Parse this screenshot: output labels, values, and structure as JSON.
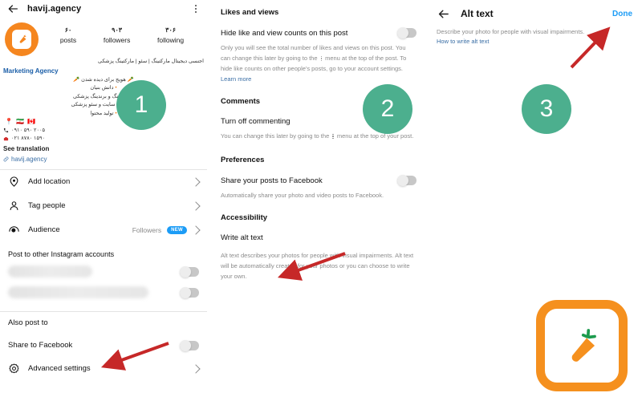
{
  "steps": [
    {
      "number": "1"
    },
    {
      "number": "2"
    },
    {
      "number": "3"
    }
  ],
  "colors": {
    "step_circle": "#4CAF8E",
    "brand_orange": "#F5901E",
    "link_blue": "#3a6ea5",
    "action_blue": "#1c9cf6",
    "arrow_red": "#C62828",
    "muted_text": "#8b8b8b"
  },
  "panel1": {
    "topbar": {
      "back_icon": "arrow-left-icon",
      "title": "havij.agency",
      "menu_icon": "kebab-menu-icon"
    },
    "profile": {
      "avatar_icon": "carrot-logo-avatar",
      "stats": [
        {
          "number": "۶۰",
          "label": "posts"
        },
        {
          "number": "۹۰۳",
          "label": "followers"
        },
        {
          "number": "۳۰۶",
          "label": "following"
        }
      ],
      "bio_headline": "اجنسی دیجیتال مارکتینگ | سئو | مارکتینگ پزشکی",
      "category": "Marketing Agency",
      "tagline": "🥕 هویج برای دیده شدن 🥕",
      "bullets": [
        "دانش بنیان",
        "مارکتینگ و برندینگ پزشکی",
        "طراحی سایت و سئو پزشکی",
        "تولید محتوا"
      ],
      "flags": "📍 🇮🇷 🇨🇦",
      "phone1_icon": "phone-icon",
      "phone1": "۰۹۱۰ ۵۹۰ ۲۰۰۵",
      "phone2_icon": "telephone-icon",
      "phone2": "۰۲۱ ۸۷۸۰ ۱۵۹۰",
      "see_translation": "See translation",
      "link_icon": "link-icon",
      "link_text": "havij.agency"
    },
    "rows": [
      {
        "icon": "location-pin-icon",
        "label": "Add location",
        "value": "",
        "badge": "",
        "chevron": true
      },
      {
        "icon": "person-icon",
        "label": "Tag people",
        "value": "",
        "badge": "",
        "chevron": true
      },
      {
        "icon": "audience-icon",
        "label": "Audience",
        "value": "Followers",
        "badge": "NEW",
        "chevron": true
      }
    ],
    "other_accounts_title": "Post to other Instagram accounts",
    "blurred_rows": [
      {
        "toggle": "off"
      },
      {
        "toggle": "off"
      }
    ],
    "also_post_to_title": "Also post to",
    "share_facebook_label": "Share to Facebook",
    "share_facebook_toggle": "off",
    "advanced_settings": {
      "icon": "gear-icon",
      "label": "Advanced settings",
      "chevron": true
    }
  },
  "panel2": {
    "likes_heading": "Likes and views",
    "hide_counts_label": "Hide like and view counts on this post",
    "hide_counts_toggle": "off",
    "hide_counts_body_a": "Only you will see the total number of likes and views on this post. You can change this later by going to the",
    "hide_counts_body_b": "menu at the top of the post. To hide like counts on other people's posts, go to your account settings.",
    "learn_more": "Learn more",
    "comments_heading": "Comments",
    "turn_off_commenting_label": "Turn off commenting",
    "commenting_body_a": "You can change this later by going to the",
    "commenting_body_b": "menu at the top of your post.",
    "preferences_heading": "Preferences",
    "share_posts_fb_label": "Share your posts to Facebook",
    "share_posts_fb_toggle": "off",
    "share_posts_fb_body": "Automatically share your photo and video posts to Facebook.",
    "accessibility_heading": "Accessibility",
    "write_alt_text_label": "Write alt text",
    "alt_text_body": "Alt text describes your photos for people with visual impairments. Alt text will be automatically created for your photos or you can choose to write your own."
  },
  "panel3": {
    "back_icon": "arrow-left-icon",
    "title": "Alt text",
    "done_label": "Done",
    "subtitle": "Describe your photo for people with visual impairments.",
    "help_link": "How to write alt text"
  },
  "watermark": {
    "icon": "carrot-logo-watermark"
  }
}
